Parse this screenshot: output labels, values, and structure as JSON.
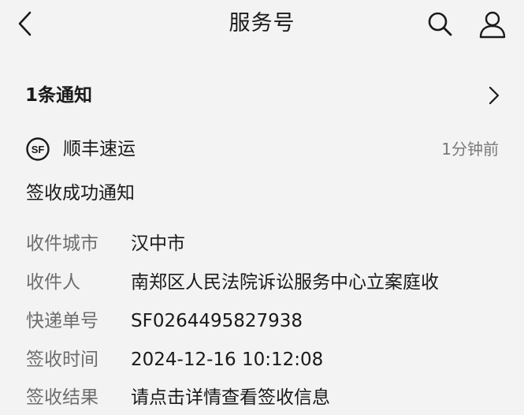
{
  "header": {
    "title": "服务号",
    "back_icon": "chevron-left-icon",
    "search_icon": "search-icon",
    "profile_icon": "person-icon"
  },
  "notice": {
    "title": "1条通知",
    "chevron_icon": "chevron-right-icon"
  },
  "card": {
    "sender_logo": "sf-express-logo",
    "sender_logo_text": "SF",
    "sender_name": "顺丰速运",
    "time": "1分钟前",
    "title": "签收成功通知",
    "fields": [
      {
        "label": "收件城市",
        "value": "汉中市"
      },
      {
        "label": "收件人",
        "value": "南郑区人民法院诉讼服务中心立案庭收"
      },
      {
        "label": "快递单号",
        "value": "SF0264495827938"
      },
      {
        "label": "签收时间",
        "value": "2024-12-16 10:12:08"
      },
      {
        "label": "签收结果",
        "value": "请点击详情查看签收信息"
      }
    ]
  },
  "colors": {
    "background": "#f3f3f3",
    "primary_text": "#1a1a1a",
    "secondary_text": "#6d6d6d",
    "muted_text": "#7a7a7a"
  }
}
